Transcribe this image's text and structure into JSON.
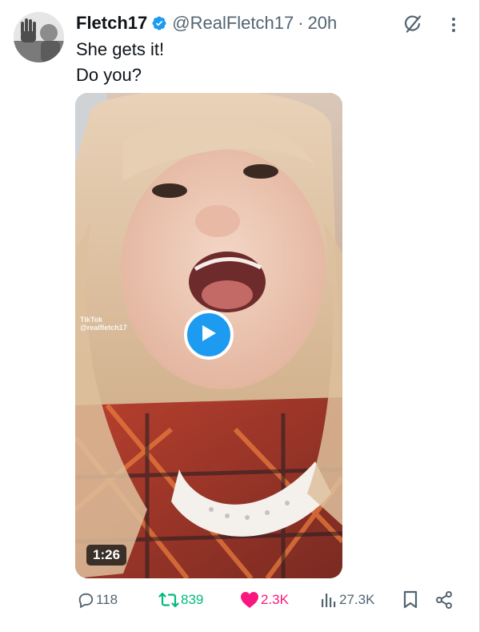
{
  "tweet": {
    "author_name": "Fletch17",
    "handle": "@RealFletch17",
    "separator": "·",
    "time": "20h",
    "text_lines": [
      "She gets it!",
      "Do you?"
    ]
  },
  "media": {
    "duration": "1:26",
    "watermark_brand": "TikTok",
    "watermark_user": "@realfletch17",
    "play_icon": "play-icon"
  },
  "actions": {
    "replies": "118",
    "retweets": "839",
    "likes": "2.3K",
    "views": "27.3K"
  },
  "colors": {
    "accent_blue": "#1d9bf0",
    "retweet_green": "#00ba7c",
    "like_pink": "#f91880",
    "muted_gray": "#536471",
    "text_dark": "#0f1419"
  },
  "icons": {
    "verified": "verified-badge-icon",
    "grok": "grok-icon",
    "more": "more-dots-icon",
    "reply": "reply-icon",
    "retweet": "retweet-icon",
    "like": "heart-icon",
    "views": "views-icon",
    "bookmark": "bookmark-icon",
    "share": "share-icon"
  }
}
